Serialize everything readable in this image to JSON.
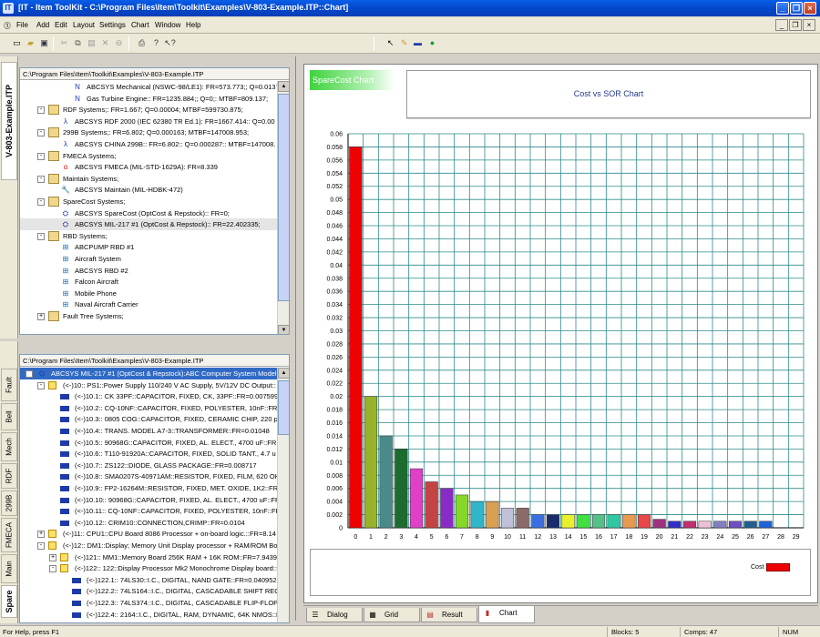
{
  "window": {
    "title": "[IT - Item ToolKit - C:\\Program Files\\Item\\Toolkit\\Examples\\V-803-Example.ITP::Chart]"
  },
  "menu": [
    "File",
    "Add",
    "Edit",
    "Layout",
    "Settings",
    "Chart",
    "Window",
    "Help"
  ],
  "left_tabs_top": {
    "label": "V-803-Example.ITP"
  },
  "left_tabs_bottom": [
    "Fault",
    "Bell",
    "Mech",
    "RDF",
    "299B",
    "FMECA",
    "Main",
    "Spare"
  ],
  "top_tree": {
    "path": "C:\\Program Files\\Item\\Toolkit\\Examples\\V-803-Example.ITP",
    "rows": [
      {
        "indent": 3,
        "icon": "nswc-icon",
        "text": "ABCSYS Mechanical (NSWC-98/LE1): FR=573.773;; Q=0.0137;"
      },
      {
        "indent": 3,
        "icon": "nswc-icon",
        "text": "Gas Turbine Engine:: FR=1235.884;; Q=0;: MTBF=809.137;"
      },
      {
        "indent": 1,
        "icon": "folder",
        "exp": "-",
        "text": "RDF Systems;: FR=1.667; Q=0.00004; MTBF=599730.875;"
      },
      {
        "indent": 2,
        "icon": "rdf-icon",
        "text": "ABCSYS RDF 2000 (IEC 62380 TR Ed.1): FR=1667.414:: Q=0.00"
      },
      {
        "indent": 1,
        "icon": "folder",
        "exp": "-",
        "text": "299B Systems;: FR=6.802; Q=0.000163; MTBF=147008.953;"
      },
      {
        "indent": 2,
        "icon": "china-icon",
        "text": "ABCSYS CHINA 299B:: FR=6.802:: Q=0.000287:: MTBF=147008."
      },
      {
        "indent": 1,
        "icon": "folder",
        "exp": "-",
        "text": "FMECA Systems;"
      },
      {
        "indent": 2,
        "icon": "fmeca-icon",
        "text": "ABCSYS FMECA (MIL-STD-1629A): FR=8.339"
      },
      {
        "indent": 1,
        "icon": "folder",
        "exp": "-",
        "text": "Maintain Systems;"
      },
      {
        "indent": 2,
        "icon": "wrench-icon",
        "text": "ABCSYS Maintain (MIL-HDBK-472)"
      },
      {
        "indent": 1,
        "icon": "folder",
        "exp": "-",
        "text": "SpareCost Systems;"
      },
      {
        "indent": 2,
        "icon": "spare-icon",
        "text": "ABCSYS SpareCost (OptCost & Repstock):: FR=0;"
      },
      {
        "indent": 2,
        "icon": "spare-icon",
        "text": "ABCSYS MIL-217 #1 (OptCost & Repstock):: FR=22.402335;",
        "selected": true
      },
      {
        "indent": 1,
        "icon": "folder",
        "exp": "-",
        "text": "RBD Systems;"
      },
      {
        "indent": 2,
        "icon": "rbd-icon",
        "text": "ABCPUMP RBD #1"
      },
      {
        "indent": 2,
        "icon": "rbd-icon",
        "text": "Aircraft System"
      },
      {
        "indent": 2,
        "icon": "rbd-icon",
        "text": "ABCSYS RBD #2"
      },
      {
        "indent": 2,
        "icon": "rbd-icon",
        "text": "Falcon Aircraft"
      },
      {
        "indent": 2,
        "icon": "rbd-icon",
        "text": "Mobile Phone"
      },
      {
        "indent": 2,
        "icon": "rbd-icon",
        "text": "Naval Aircraft Carrier"
      },
      {
        "indent": 1,
        "icon": "folder",
        "exp": "+",
        "text": "Fault Tree Systems;"
      }
    ]
  },
  "bottom_tree": {
    "path": "C:\\Program Files\\Item\\Toolkit\\Examples\\V-803-Example.ITP",
    "rows": [
      {
        "indent": 0,
        "icon": "spare-icon",
        "exp": "-",
        "text": "ABCSYS MIL-217 #1 (OptCost & Repstock):ABC Computer System Model #",
        "selected": true
      },
      {
        "indent": 1,
        "icon": "part",
        "exp": "-",
        "text": "(<-)10:: PS1::Power Supply 110/240 V AC Supply, 5V/12V DC Output::"
      },
      {
        "indent": 2,
        "icon": "comp",
        "text": "(<-)10.1:: CK 33PF::CAPACITOR, FIXED, CK, 33PF::FR=0.007599"
      },
      {
        "indent": 2,
        "icon": "comp",
        "text": "(<-)10.2:: CQ-10NF::CAPACITOR, FIXED, POLYESTER, 10nF::FR"
      },
      {
        "indent": 2,
        "icon": "comp",
        "text": "(<-)10.3:: 0805 COG::CAPACITOR, FIXED, CERAMIC CHIP, 220 p"
      },
      {
        "indent": 2,
        "icon": "comp",
        "text": "(<-)10.4:: TRANS. MODEL A7-3::TRANSFORMER::FR=0.01048"
      },
      {
        "indent": 2,
        "icon": "comp",
        "text": "(<-)10.5:: 90968G::CAPACITOR, FIXED, AL. ELECT., 4700 uF::FR"
      },
      {
        "indent": 2,
        "icon": "comp",
        "text": "(<-)10.6:: T110-91920A::CAPACITOR, FIXED, SOLID TANT., 4.7 u"
      },
      {
        "indent": 2,
        "icon": "comp",
        "text": "(<-)10.7:: ZS122::DIODE, GLASS PACKAGE::FR=0.008717"
      },
      {
        "indent": 2,
        "icon": "comp",
        "text": "(<-)10.8:: SMA0207S-40971AM::RESISTOR, FIXED, FILM, 620 OH"
      },
      {
        "indent": 2,
        "icon": "comp",
        "text": "(<-)10.9:: FP2-16264M::RESISTOR, FIXED, MET. OXIDE, 1K2::FR"
      },
      {
        "indent": 2,
        "icon": "comp",
        "text": "(<-)10.10:: 90968G::CAPACITOR, FIXED, AL. ELECT., 4700 uF::FR"
      },
      {
        "indent": 2,
        "icon": "comp",
        "text": "(<-)10.11:: CQ-10NF::CAPACITOR, FIXED, POLYESTER, 10nF::FR"
      },
      {
        "indent": 2,
        "icon": "comp",
        "text": "(<-)10.12:: CRIM10::CONNECTION,CRIMP::FR=0.0104"
      },
      {
        "indent": 1,
        "icon": "part",
        "exp": "+",
        "text": "(<-)11:: CPU1::CPU Board 8086 Processor + on-board logic.::FR=8.14"
      },
      {
        "indent": 1,
        "icon": "part",
        "exp": "-",
        "text": "(<-)12:: DM1::Display; Memory Unit Display processor + RAM/ROM Bo"
      },
      {
        "indent": 2,
        "icon": "part",
        "exp": "+",
        "text": "(<-)121:: MM1::Memory Board 256K RAM + 16K ROM::FR=7.9439"
      },
      {
        "indent": 2,
        "icon": "part",
        "exp": "-",
        "text": "(<-)122:: 122::Display Processor Mk2 Monochrome Display board::"
      },
      {
        "indent": 3,
        "icon": "comp",
        "text": "(<-)122.1:: 74LS30::I.C., DIGITAL, NAND GATE::FR=0.040952"
      },
      {
        "indent": 3,
        "icon": "comp",
        "text": "(<-)122.2:: 74LS164::I.C., DIGITAL, CASCADABLE SHIFT REG"
      },
      {
        "indent": 3,
        "icon": "comp",
        "text": "(<-)122.3:: 74LS374::I.C., DIGITAL, CASCADABLE FLIP-FLOP"
      },
      {
        "indent": 3,
        "icon": "comp",
        "text": "(<-)122.4:: 2164::I.C., DIGITAL, RAM, DYNAMIC, 64K NMOS::FR=0.046"
      },
      {
        "indent": 3,
        "icon": "comp",
        "text": "(<-)122.5:: 90968G::CAPACITOR, FIXED, AL. ELECT., 4700 u"
      },
      {
        "indent": 3,
        "icon": "comp",
        "text": "(<-)122.6:: CV1S4222K::CAPACITOR, FIXED, CERAMIC, 220"
      }
    ]
  },
  "chart_tab_label": "SpareCost Chart",
  "chart_data": {
    "type": "bar",
    "title": "Cost vs SOR Chart",
    "xlabel": "",
    "ylabel": "",
    "categories": [
      "0",
      "1",
      "2",
      "3",
      "4",
      "5",
      "6",
      "7",
      "8",
      "9",
      "10",
      "11",
      "12",
      "13",
      "14",
      "15",
      "16",
      "17",
      "18",
      "19",
      "20",
      "21",
      "22",
      "23",
      "24",
      "25",
      "26",
      "27",
      "28",
      "29"
    ],
    "series": [
      {
        "name": "Cost",
        "values": [
          0.058,
          0.02,
          0.014,
          0.012,
          0.009,
          0.007,
          0.006,
          0.005,
          0.004,
          0.004,
          0.003,
          0.003,
          0.002,
          0.002,
          0.002,
          0.002,
          0.002,
          0.002,
          0.002,
          0.002,
          0.0013,
          0.001,
          0.001,
          0.001,
          0.001,
          0.001,
          0.001,
          0.001,
          null,
          null
        ]
      }
    ],
    "bar_colors": [
      "#ee0000",
      "#99b22c",
      "#4a8a8a",
      "#1d6b2f",
      "#e040c8",
      "#c44444",
      "#8a2bc8",
      "#86d828",
      "#30b6c8",
      "#d8a050",
      "#c0c0d8",
      "#8c6a6a",
      "#3b6ee0",
      "#1b2b6b",
      "#e8f22a",
      "#40e040",
      "#56c08a",
      "#30c8a0",
      "#e89a50",
      "#e84848",
      "#a03080",
      "#3030c8",
      "#c03070",
      "#f0c0d8",
      "#8080c0",
      "#7050c0",
      "#206090",
      "#2060d8"
    ],
    "ylim": [
      0,
      0.06
    ],
    "ytick_step": 0.002,
    "yticks": [
      "0",
      "0.002",
      "0.004",
      "0.006",
      "0.008",
      "0.01",
      "0.012",
      "0.014",
      "0.016",
      "0.018",
      "0.02",
      "0.022",
      "0.024",
      "0.026",
      "0.028",
      "0.03",
      "0.032",
      "0.034",
      "0.036",
      "0.038",
      "0.04",
      "0.042",
      "0.044",
      "0.046",
      "0.048",
      "0.05",
      "0.052",
      "0.054",
      "0.056",
      "0.058",
      "0.06"
    ],
    "grid": true,
    "legend_position": "bottom-right"
  },
  "bottom_tabs": [
    {
      "icon": "dialog-icon",
      "label": "Dialog"
    },
    {
      "icon": "grid-icon",
      "label": "Grid"
    },
    {
      "icon": "result-icon",
      "label": "Result"
    },
    {
      "icon": "chart-icon",
      "label": "Chart",
      "active": true
    }
  ],
  "status": {
    "help": "For Help, press F1",
    "blocks": "Blocks: 5",
    "comps": "Comps: 47",
    "num": "NUM"
  }
}
